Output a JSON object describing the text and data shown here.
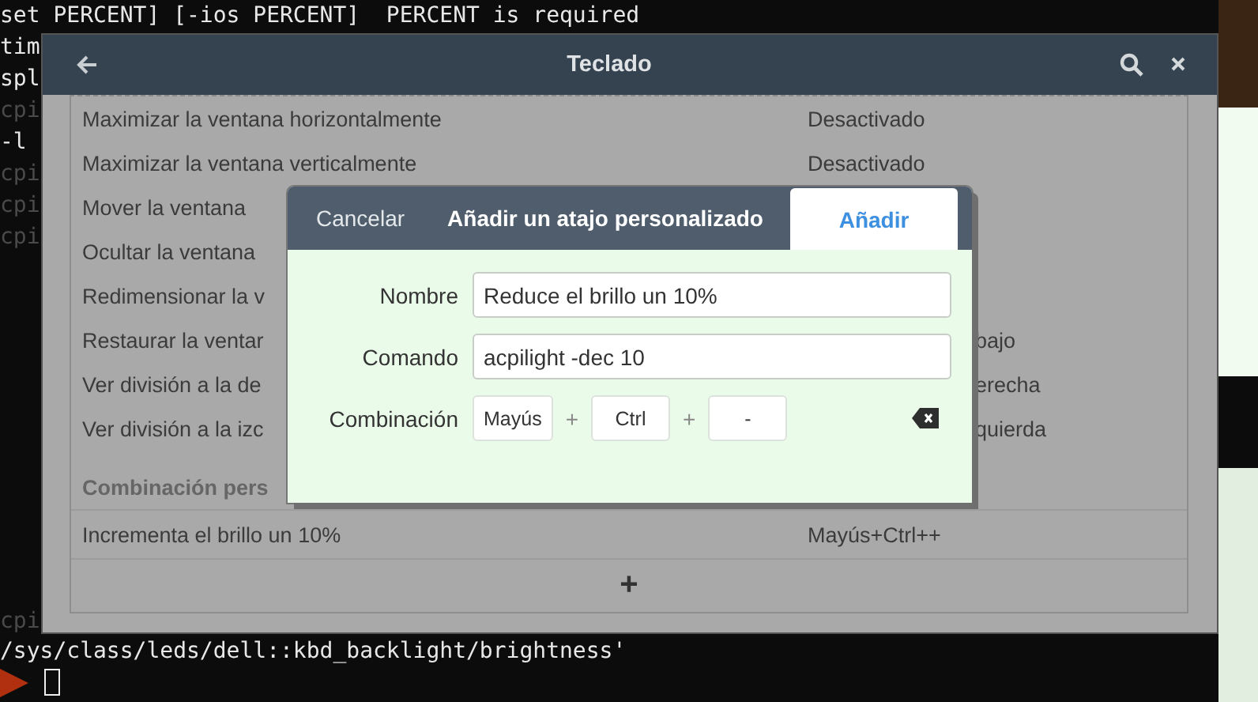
{
  "terminal": {
    "lines": [
      {
        "text": "set PERCENT] [-ios PERCENT]  PERCENT is required",
        "dim": false
      },
      {
        "text": "tim",
        "dim": false
      },
      {
        "text": "spl",
        "dim": false
      },
      {
        "text": "cpi",
        "dim": true
      },
      {
        "text": "-l",
        "dim": false
      },
      {
        "text": "cpi",
        "dim": true
      },
      {
        "text": "cpi",
        "dim": true
      },
      {
        "text": "cpi",
        "dim": true
      }
    ],
    "last_lines": [
      {
        "text": "cpi",
        "dim": true
      },
      {
        "text": "/sys/class/leds/dell::kbd_backlight/brightness'",
        "dim": false
      }
    ]
  },
  "window": {
    "title": "Teclado",
    "shortcuts": [
      {
        "kind": "full",
        "name": "Maximizar la ventana horizontalmente",
        "value": "Desactivado"
      },
      {
        "kind": "full",
        "name": "Maximizar la ventana verticalmente",
        "value": "Desactivado"
      },
      {
        "kind": "covered",
        "name": "Mover la ventana"
      },
      {
        "kind": "covered",
        "name": "Ocultar la ventana"
      },
      {
        "kind": "covered",
        "name": "Redimensionar la v"
      },
      {
        "kind": "covered",
        "name": "Restaurar la ventar",
        "value": "bajo"
      },
      {
        "kind": "covered",
        "name": "Ver división a la de",
        "value": "erecha"
      },
      {
        "kind": "covered",
        "name": "Ver división a la izc",
        "value": "quierda"
      }
    ],
    "section_title": "Combinación pers",
    "custom_shortcuts": [
      {
        "name": "Incrementa el brillo un 10%",
        "value": "Mayús+Ctrl++"
      }
    ],
    "add_button": "+"
  },
  "dialog": {
    "cancel": "Cancelar",
    "title": "Añadir un atajo personalizado",
    "confirm": "Añadir",
    "fields": [
      {
        "label": "Nombre",
        "value": "Reduce el brillo un 10%"
      },
      {
        "label": "Comando",
        "value": "acpilight -dec 10"
      }
    ],
    "combination": {
      "label": "Combinación",
      "keys": [
        "Mayús",
        "Ctrl",
        "-"
      ],
      "separators": [
        "+",
        "+"
      ]
    }
  }
}
